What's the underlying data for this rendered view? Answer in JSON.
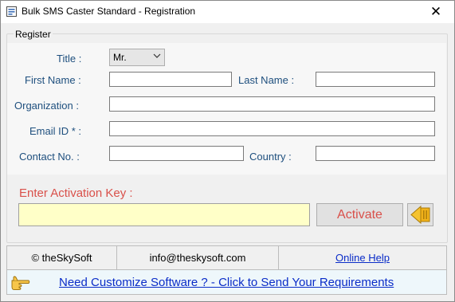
{
  "window": {
    "title": "Bulk SMS Caster Standard  - Registration",
    "close_glyph": "✕"
  },
  "register": {
    "legend": "Register",
    "title_label": "Title :",
    "title_value": "Mr.",
    "first_name_label": "First Name :",
    "first_name_value": "",
    "last_name_label": "Last Name :",
    "last_name_value": "",
    "organization_label": "Organization :",
    "organization_value": "",
    "email_label": "Email ID * :",
    "email_value": "",
    "contact_label": "Contact No. :",
    "contact_value": "",
    "country_label": "Country :",
    "country_value": ""
  },
  "activation": {
    "label": "Enter Activation Key  :",
    "key_value": "",
    "activate_label": "Activate",
    "back_icon": "arrow-left-icon"
  },
  "footer": {
    "copyright": "© theSkySoft",
    "email": "info@theskysoft.com",
    "help_link": "Online Help"
  },
  "banner": {
    "icon": "pointing-hand-icon",
    "text": "Need Customize Software ? - Click to Send Your Requirements"
  },
  "colors": {
    "label_blue": "#1e4f7e",
    "activation_red": "#d9504a",
    "key_field_yellow": "#ffffc8",
    "link_blue": "#0a2cc8",
    "banner_bg": "#eef7fb"
  }
}
